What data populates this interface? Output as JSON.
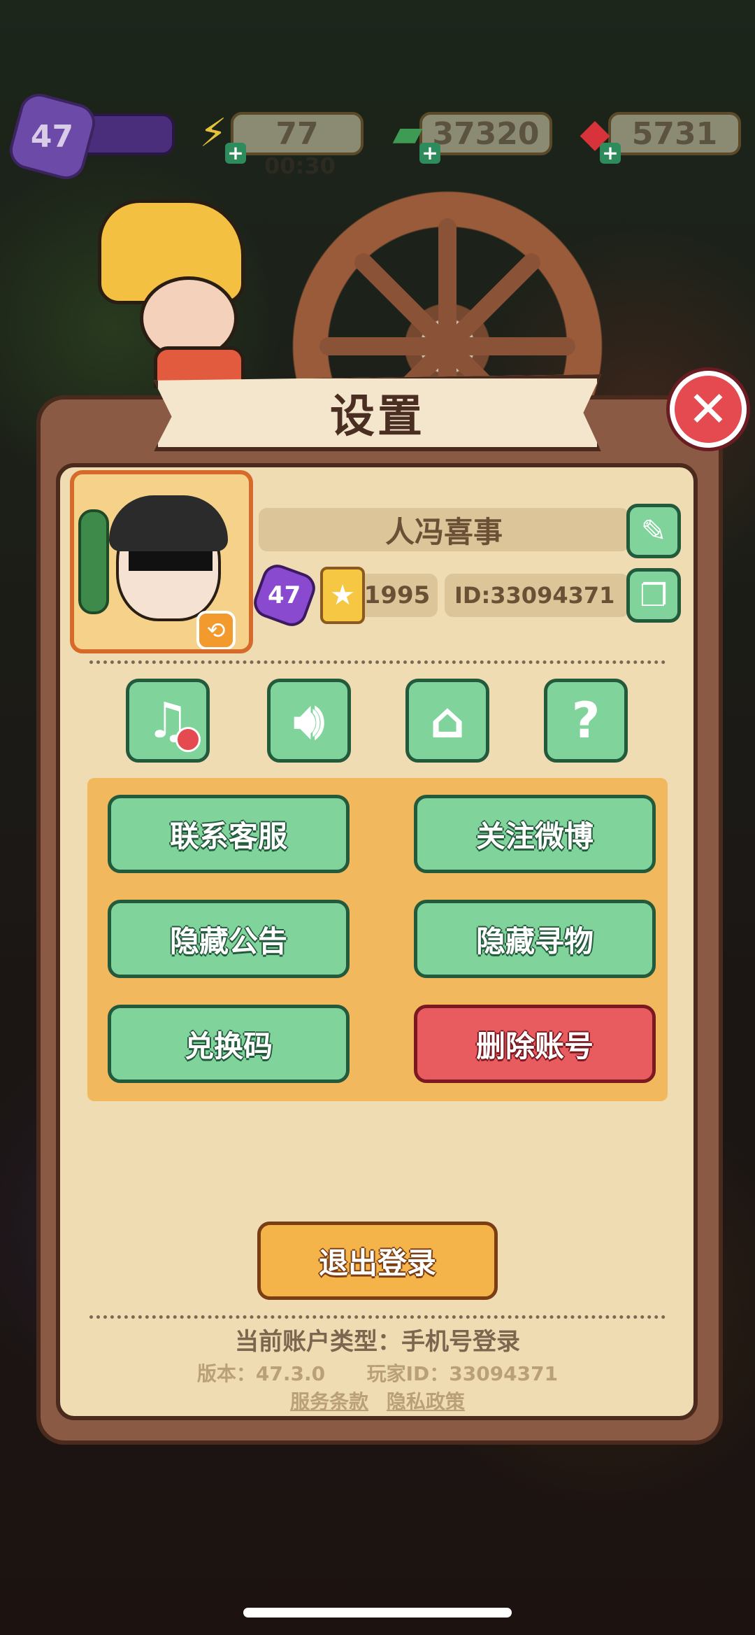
{
  "hud": {
    "level": "47",
    "energy": "77",
    "energy_timer": "00:30",
    "cash": "37320",
    "gems": "5731"
  },
  "settings": {
    "title": "设置",
    "close_icon": "close-icon"
  },
  "profile": {
    "name": "人冯喜事",
    "level": "47",
    "stars": "1995",
    "id_text": "ID:33094371"
  },
  "toggles": [
    {
      "name": "music",
      "icon": "music-note-icon"
    },
    {
      "name": "sound",
      "icon": "speaker-icon"
    },
    {
      "name": "clean",
      "icon": "broom-icon"
    },
    {
      "name": "help",
      "icon": "question-icon"
    }
  ],
  "buttons": {
    "contact_support": "联系客服",
    "follow_weibo": "关注微博",
    "hide_announcements": "隐藏公告",
    "hide_item_hunt": "隐藏寻物",
    "redeem_code": "兑换码",
    "delete_account": "删除账号",
    "logout": "退出登录"
  },
  "footer": {
    "account_type": "当前账户类型：手机号登录",
    "version": "版本：47.3.0",
    "player_id": "玩家ID：33094371",
    "terms": "服务条款",
    "privacy": "隐私政策"
  },
  "colors": {
    "green_button": "#7fd39b",
    "red_button": "#e85b5f",
    "orange_button": "#f5b44a",
    "panel_bg": "#f0dcb2"
  }
}
